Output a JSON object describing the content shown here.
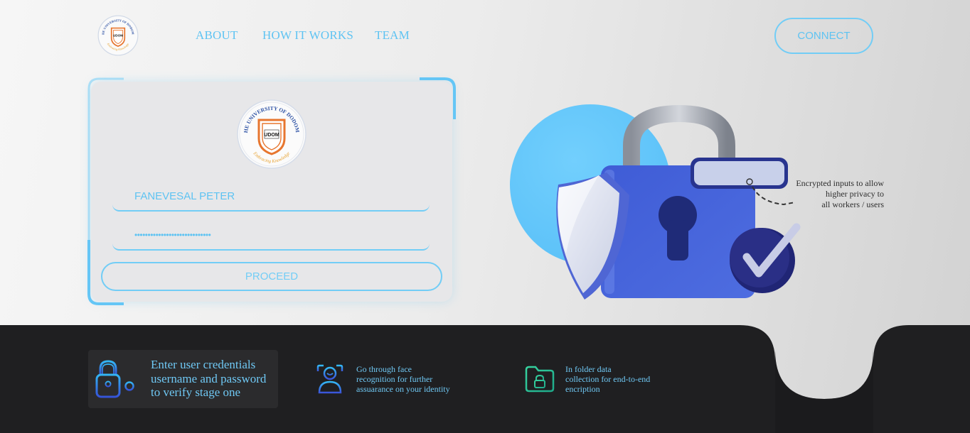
{
  "header": {
    "logo_icon": "university-of-dodoma-logo",
    "nav": [
      {
        "label": "ABOUT"
      },
      {
        "label": "HOW IT WORKS"
      },
      {
        "label": "TEAM"
      }
    ],
    "connect_label": "CONNECT"
  },
  "login": {
    "logo": {
      "arc_top": "THE UNIVERSITY OF DODOMA",
      "shield_text": "UDOM",
      "arc_bottom": "Embracing Knowledge"
    },
    "username_value": "FANEVESAL PETER",
    "password_value": "•••••••••••••••••••••••••••••",
    "proceed_label": "PROCEED"
  },
  "illustration": {
    "icon": "padlock-shield-check-icon",
    "caption": [
      "Encrypted inputs to allow",
      "higher privacy to",
      "all workers / users"
    ]
  },
  "steps": [
    {
      "icon": "lock-key-icon",
      "text": [
        "Enter user credentials",
        "username and password",
        "to verify stage one"
      ]
    },
    {
      "icon": "face-recognition-icon",
      "text": [
        "Go through face",
        "recognition for further",
        "assuarance on your identity"
      ]
    },
    {
      "icon": "locked-folder-icon",
      "text": [
        "In folder data",
        "collection for end-to-end",
        "encription"
      ]
    }
  ],
  "colors": {
    "accent": "#5ec3f2",
    "band": "#1f1f21",
    "lock_body": "#4763d8",
    "circle": "#64c8fa"
  }
}
